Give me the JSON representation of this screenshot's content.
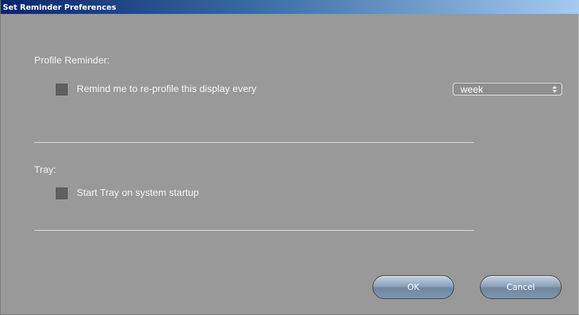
{
  "window": {
    "title": "Set Reminder Preferences"
  },
  "profile_reminder": {
    "section_label": "Profile Reminder:",
    "checkbox_label": "Remind me to re-profile this display every",
    "checked": false,
    "interval": {
      "selected": "week"
    }
  },
  "tray": {
    "section_label": "Tray:",
    "checkbox_label": "Start Tray on system startup",
    "checked": false
  },
  "buttons": {
    "ok_label": "OK",
    "cancel_label": "Cancel"
  },
  "colors": {
    "panel_background": "#999999",
    "title_gradient_start": "#0a246a",
    "title_gradient_end": "#a6caf0",
    "checkbox_fill": "#606060",
    "button_blue": "#8ca3bb"
  }
}
